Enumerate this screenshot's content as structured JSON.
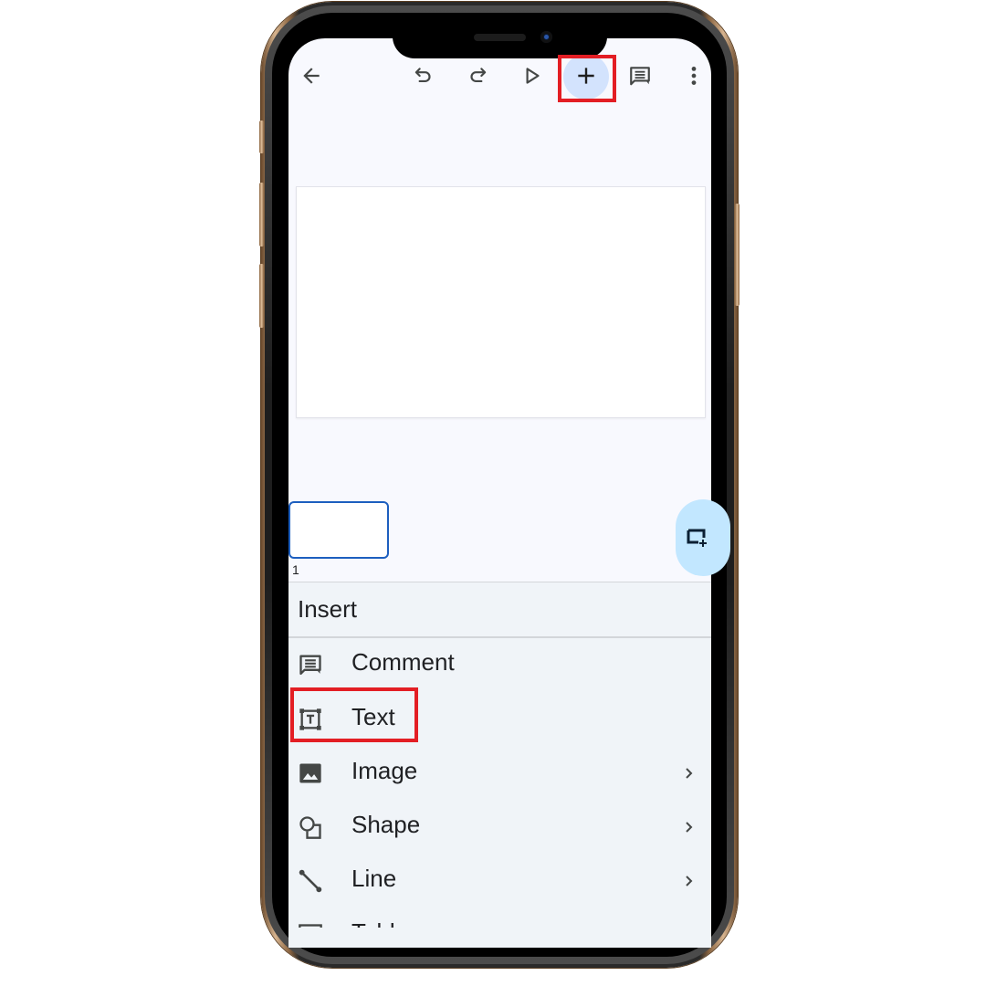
{
  "toolbar": {
    "icons": [
      "back-arrow-icon",
      "undo-icon",
      "redo-icon",
      "present-icon",
      "add-icon",
      "comment-icon",
      "more-vert-icon"
    ],
    "active": "add-icon"
  },
  "filmstrip": {
    "slide_number": "1"
  },
  "insert_panel": {
    "title": "Insert",
    "items": [
      {
        "label": "Comment",
        "icon": "comment-icon",
        "has_submenu": false
      },
      {
        "label": "Text",
        "icon": "text-box-icon",
        "has_submenu": false
      },
      {
        "label": "Image",
        "icon": "image-icon",
        "has_submenu": true
      },
      {
        "label": "Shape",
        "icon": "shape-icon",
        "has_submenu": true
      },
      {
        "label": "Line",
        "icon": "line-icon",
        "has_submenu": true
      },
      {
        "label": "Table",
        "icon": "table-icon",
        "has_submenu": false
      }
    ]
  },
  "colors": {
    "accent_bubble": "#d3e3fd",
    "highlight": "#e31e24",
    "selection_blue": "#1d5fbf",
    "new_slide_bg": "#c2e7ff"
  }
}
